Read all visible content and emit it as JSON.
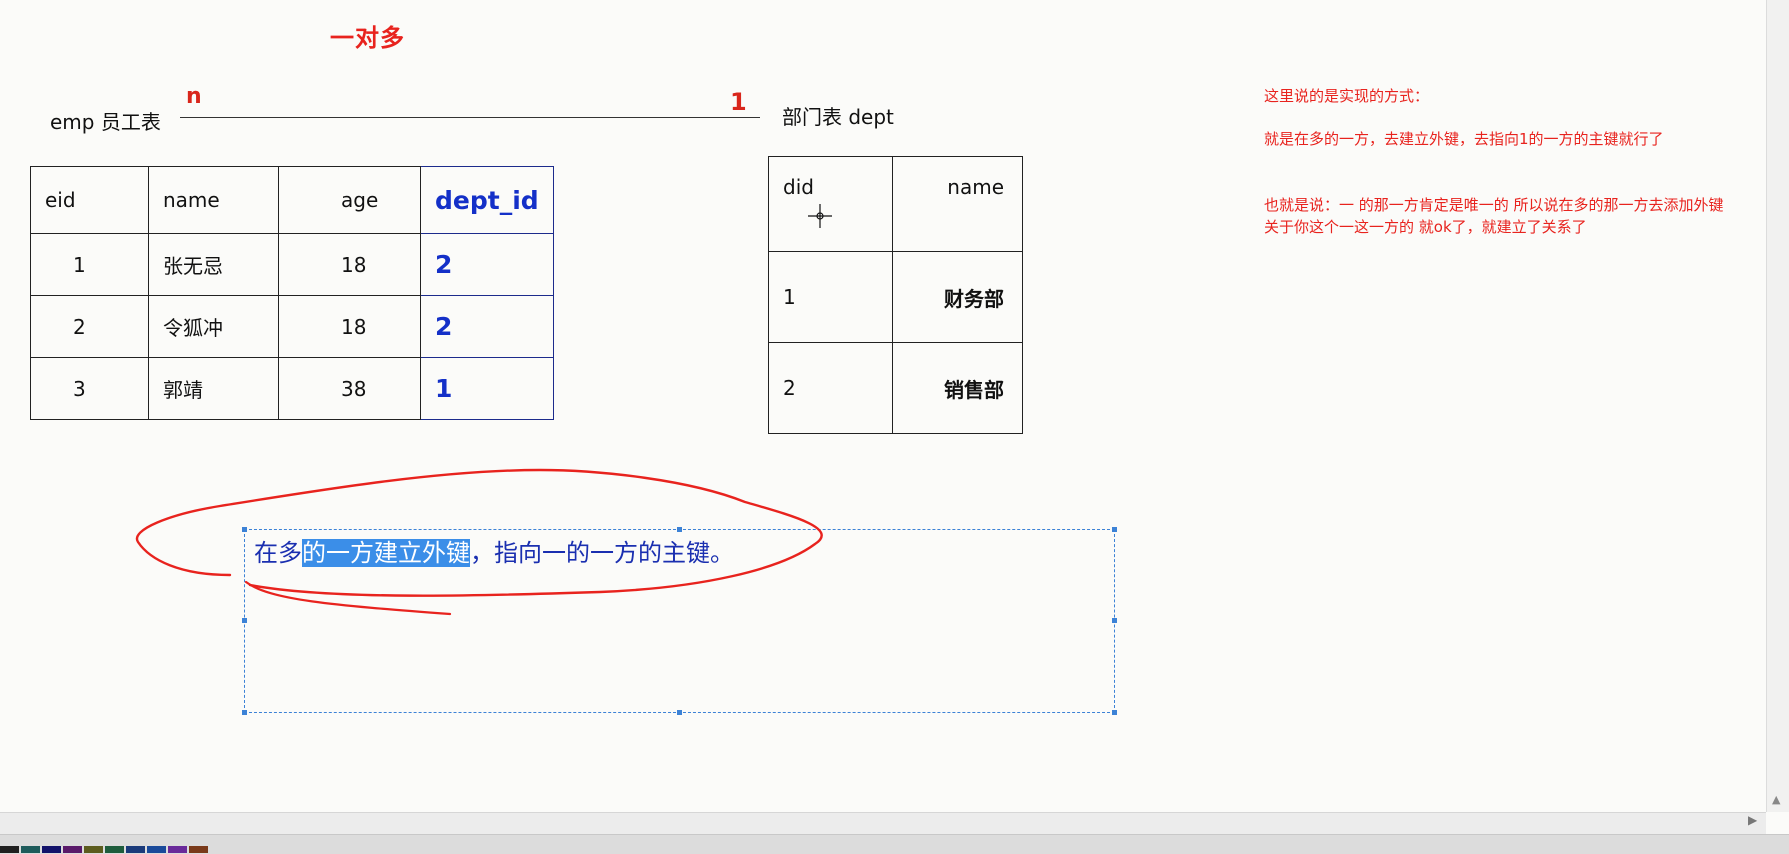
{
  "slide": {
    "title": "一对多",
    "relation": {
      "left_label": "emp 员工表",
      "right_label": "部门表  dept",
      "many_marker": "n",
      "one_marker": "1"
    },
    "emp_table": {
      "headers": [
        "eid",
        "name",
        "age",
        "dept_id"
      ],
      "rows": [
        [
          "1",
          "张无忌",
          "18",
          "2"
        ],
        [
          "2",
          "令狐冲",
          "18",
          "2"
        ],
        [
          "3",
          "郭靖",
          "38",
          "1"
        ]
      ]
    },
    "dept_table": {
      "headers": [
        "did",
        "name"
      ],
      "rows": [
        [
          "1",
          "财务部"
        ],
        [
          "2",
          "销售部"
        ]
      ]
    },
    "text_box": {
      "prefix": "在多",
      "highlighted": "的一方建立外键",
      "suffix": "，指向一的一方的主键。"
    },
    "notes": [
      "这里说的是实现的方式：",
      "就是在多的一方，去建立外键，去指向1的一方的主键就行了",
      "也就是说：一  的那一方肯定是唯一的  所以说在多的那一方去添加外键",
      "关于你这个一这一方的  就ok了，就建立了关系了"
    ]
  },
  "colors": {
    "accent_red": "#e8231e",
    "fk_blue": "#1430c8",
    "selection_blue": "#3b8ee8",
    "box_border": "#3c82d6"
  },
  "palette": [
    "#1f1f1f",
    "#1e5b5b",
    "#12126a",
    "#5a1a6a",
    "#5c5c1e",
    "#1e5c3c",
    "#1a3a7a",
    "#1a4a9a",
    "#6a2a9a",
    "#7a3a1a"
  ]
}
